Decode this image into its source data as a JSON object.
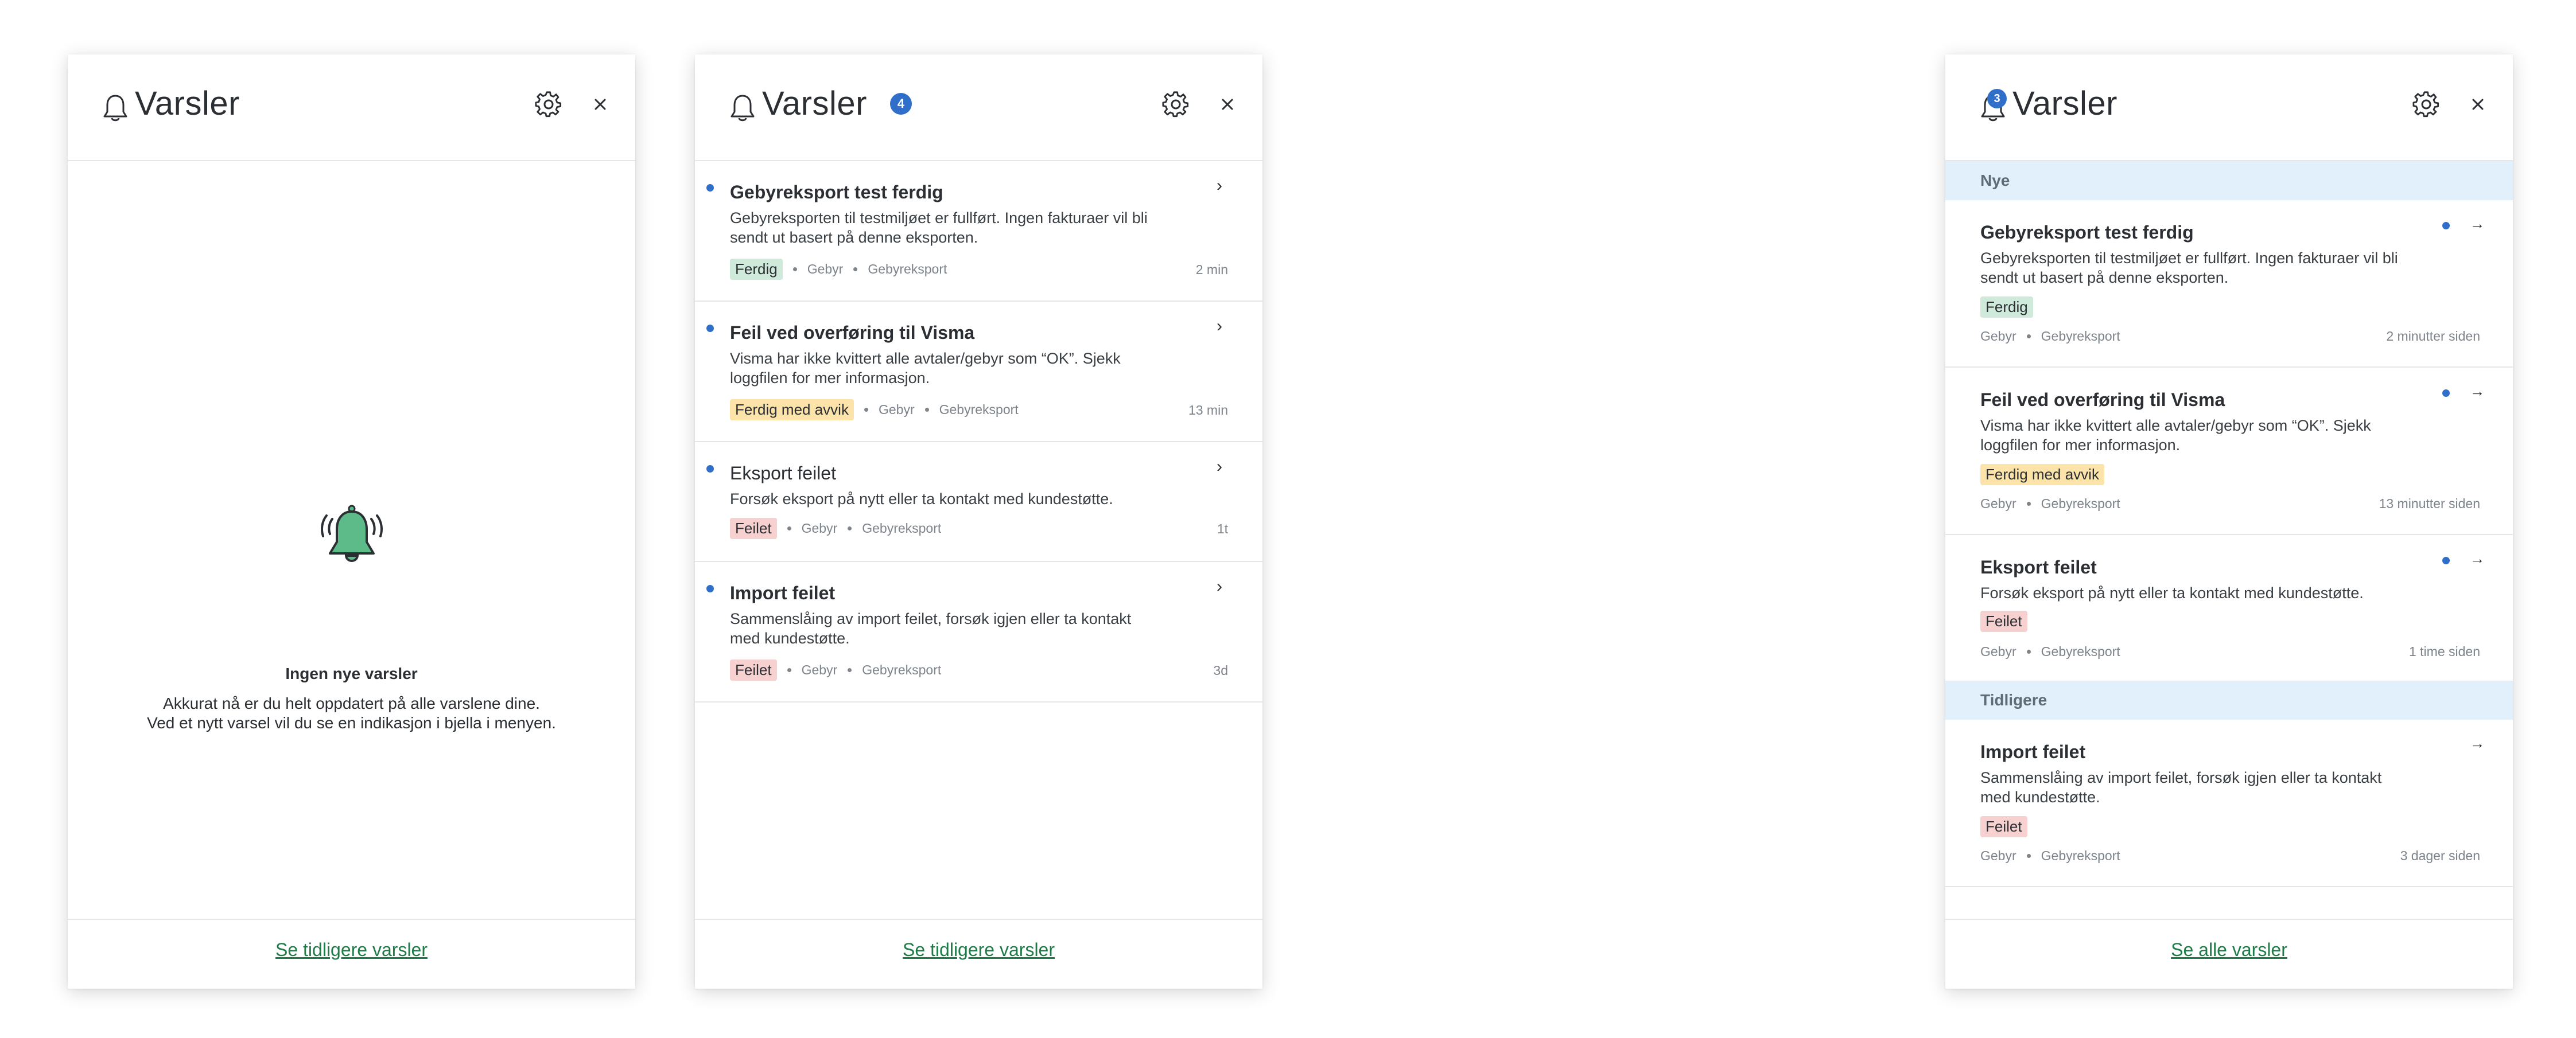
{
  "colors": {
    "accent_green": "#1e7a46",
    "unread_dot": "#2f6fc9",
    "tag_ok": "#cfeadb",
    "tag_warn": "#fbe3a9",
    "tag_err": "#f7d0d0",
    "section_bg": "#e1f0fb"
  },
  "icons": {
    "bell": "bell-icon",
    "gear": "gear-icon",
    "close": "close-icon",
    "chevron": "chevron-right-icon",
    "arrow": "arrow-right-icon"
  },
  "panel_empty": {
    "title": "Varsler",
    "empty_title": "Ingen nye varsler",
    "empty_line1": "Akkurat nå er du helt oppdatert på alle varslene dine.",
    "empty_line2": "Ved et nytt varsel vil du se en indikasjon i bjella i menyen.",
    "footer_link": "Se tidligere varsler"
  },
  "panel_list": {
    "title": "Varsler",
    "count": "4",
    "footer_link": "Se tidligere varsler",
    "items": [
      {
        "title": "Gebyreksport test ferdig",
        "desc": "Gebyreksporten til testmiljøet er fullført. Ingen fakturaer vil bli sendt ut basert på denne eksporten.",
        "tag": "Ferdig",
        "meta1": "Gebyr",
        "meta2": "Gebyreksport",
        "time": "2 min"
      },
      {
        "title": "Feil ved overføring til Visma",
        "desc": "Visma har ikke kvittert alle avtaler/gebyr som “OK”. Sjekk loggfilen for mer informasjon.",
        "tag": "Ferdig med avvik",
        "meta1": "Gebyr",
        "meta2": "Gebyreksport",
        "time": "13 min"
      },
      {
        "title": "Eksport feilet",
        "desc": "Forsøk eksport på nytt eller ta kontakt med kundestøtte.",
        "tag": "Feilet",
        "meta1": "Gebyr",
        "meta2": "Gebyreksport",
        "time": "1t"
      },
      {
        "title": "Import feilet",
        "desc": "Sammenslåing av import feilet, forsøk igjen eller ta kontakt med kundestøtte.",
        "tag": "Feilet",
        "meta1": "Gebyr",
        "meta2": "Gebyreksport",
        "time": "3d"
      }
    ]
  },
  "panel_grouped": {
    "title": "Varsler",
    "count": "3",
    "section_new": "Nye",
    "section_earlier": "Tidligere",
    "footer_link": "Se alle varsler",
    "items": [
      {
        "title": "Gebyreksport test ferdig",
        "desc": "Gebyreksporten til testmiljøet er fullført. Ingen fakturaer vil bli sendt ut basert på denne eksporten.",
        "tag": "Ferdig",
        "meta1": "Gebyr",
        "meta2": "Gebyreksport",
        "time": "2 minutter siden"
      },
      {
        "title": "Feil ved overføring til Visma",
        "desc": "Visma har ikke kvittert alle avtaler/gebyr som “OK”. Sjekk loggfilen for mer informasjon.",
        "tag": "Ferdig med avvik",
        "meta1": "Gebyr",
        "meta2": "Gebyreksport",
        "time": "13 minutter siden"
      },
      {
        "title": "Eksport feilet",
        "desc": "Forsøk eksport på nytt eller ta kontakt med kundestøtte.",
        "tag": "Feilet",
        "meta1": "Gebyr",
        "meta2": "Gebyreksport",
        "time": "1 time siden"
      },
      {
        "title": "Import feilet",
        "desc": "Sammenslåing av import feilet, forsøk igjen eller ta kontakt med kundestøtte.",
        "tag": "Feilet",
        "meta1": "Gebyr",
        "meta2": "Gebyreksport",
        "time": "3 dager siden"
      }
    ]
  }
}
